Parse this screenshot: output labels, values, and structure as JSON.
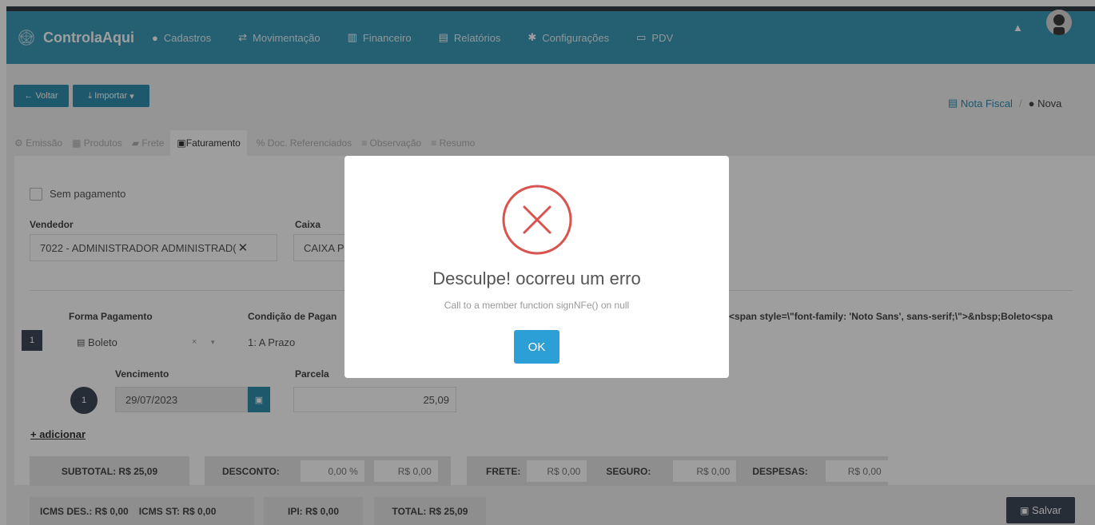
{
  "header": {
    "brand": "ControlaAqui",
    "nav": [
      {
        "label": "Cadastros",
        "icon": "plus-circle-icon"
      },
      {
        "label": "Movimentação",
        "icon": "transfer-icon"
      },
      {
        "label": "Financeiro",
        "icon": "bar-chart-icon"
      },
      {
        "label": "Relatórios",
        "icon": "document-icon"
      },
      {
        "label": "Configurações",
        "icon": "gear-icon"
      },
      {
        "label": "PDV",
        "icon": "laptop-icon"
      }
    ]
  },
  "toolbar": {
    "back_label": "Voltar",
    "import_label": "Importar"
  },
  "breadcrumb": {
    "parent": "Nota Fiscal",
    "current": "Nova"
  },
  "tabs": [
    "Emissão",
    "Produtos",
    "Frete",
    "Faturamento",
    "Doc. Referenciados",
    "Observação",
    "Resumo"
  ],
  "form": {
    "sem_pagamento": "Sem pagamento",
    "vendedor_label": "Vendedor",
    "vendedor_value": "7022 - ADMINISTRADOR ADMINISTRAD(",
    "caixa_label": "Caixa",
    "caixa_value": "CAIXA P",
    "payment_index": "1",
    "forma_label": "Forma Pagamento",
    "forma_value": "Boleto",
    "condicao_label": "Condição de Pagan",
    "condicao_value": "1: A Prazo",
    "html_leak": "<span style=\\\"font-family: 'Noto Sans', sans-serif;\\\">&nbsp;Boleto<spa",
    "vencimento_label": "Vencimento",
    "vencimento_value": "29/07/2023",
    "parcela_label": "Parcela",
    "parcela_value": "25,09",
    "parcela_index": "1",
    "add_label": "+ adicionar"
  },
  "summary": {
    "subtotal": "SUBTOTAL: R$ 25,09",
    "desconto_label": "DESCONTO:",
    "desconto_pct": "0,00 %",
    "desconto_val": "R$ 0,00",
    "frete_label": "FRETE:",
    "frete_val": "R$ 0,00",
    "seguro_label": "SEGURO:",
    "seguro_val": "R$ 0,00",
    "despesas_label": "DESPESAS:",
    "despesas_val": "R$ 0,00",
    "icms_des": "ICMS DES.: R$ 0,00",
    "icms_st": "ICMS ST: R$ 0,00",
    "ipi": "IPI: R$ 0,00",
    "total": "TOTAL: R$ 25,09"
  },
  "save_label": "Salvar",
  "modal": {
    "title": "Desculpe! ocorreu um erro",
    "message": "Call to a member function signNFe() on null",
    "ok_label": "OK"
  },
  "colors": {
    "primary": "#3a99b8",
    "dark": "#3e4a57",
    "error": "#d9534f",
    "ok_button": "#2b9fd6"
  }
}
